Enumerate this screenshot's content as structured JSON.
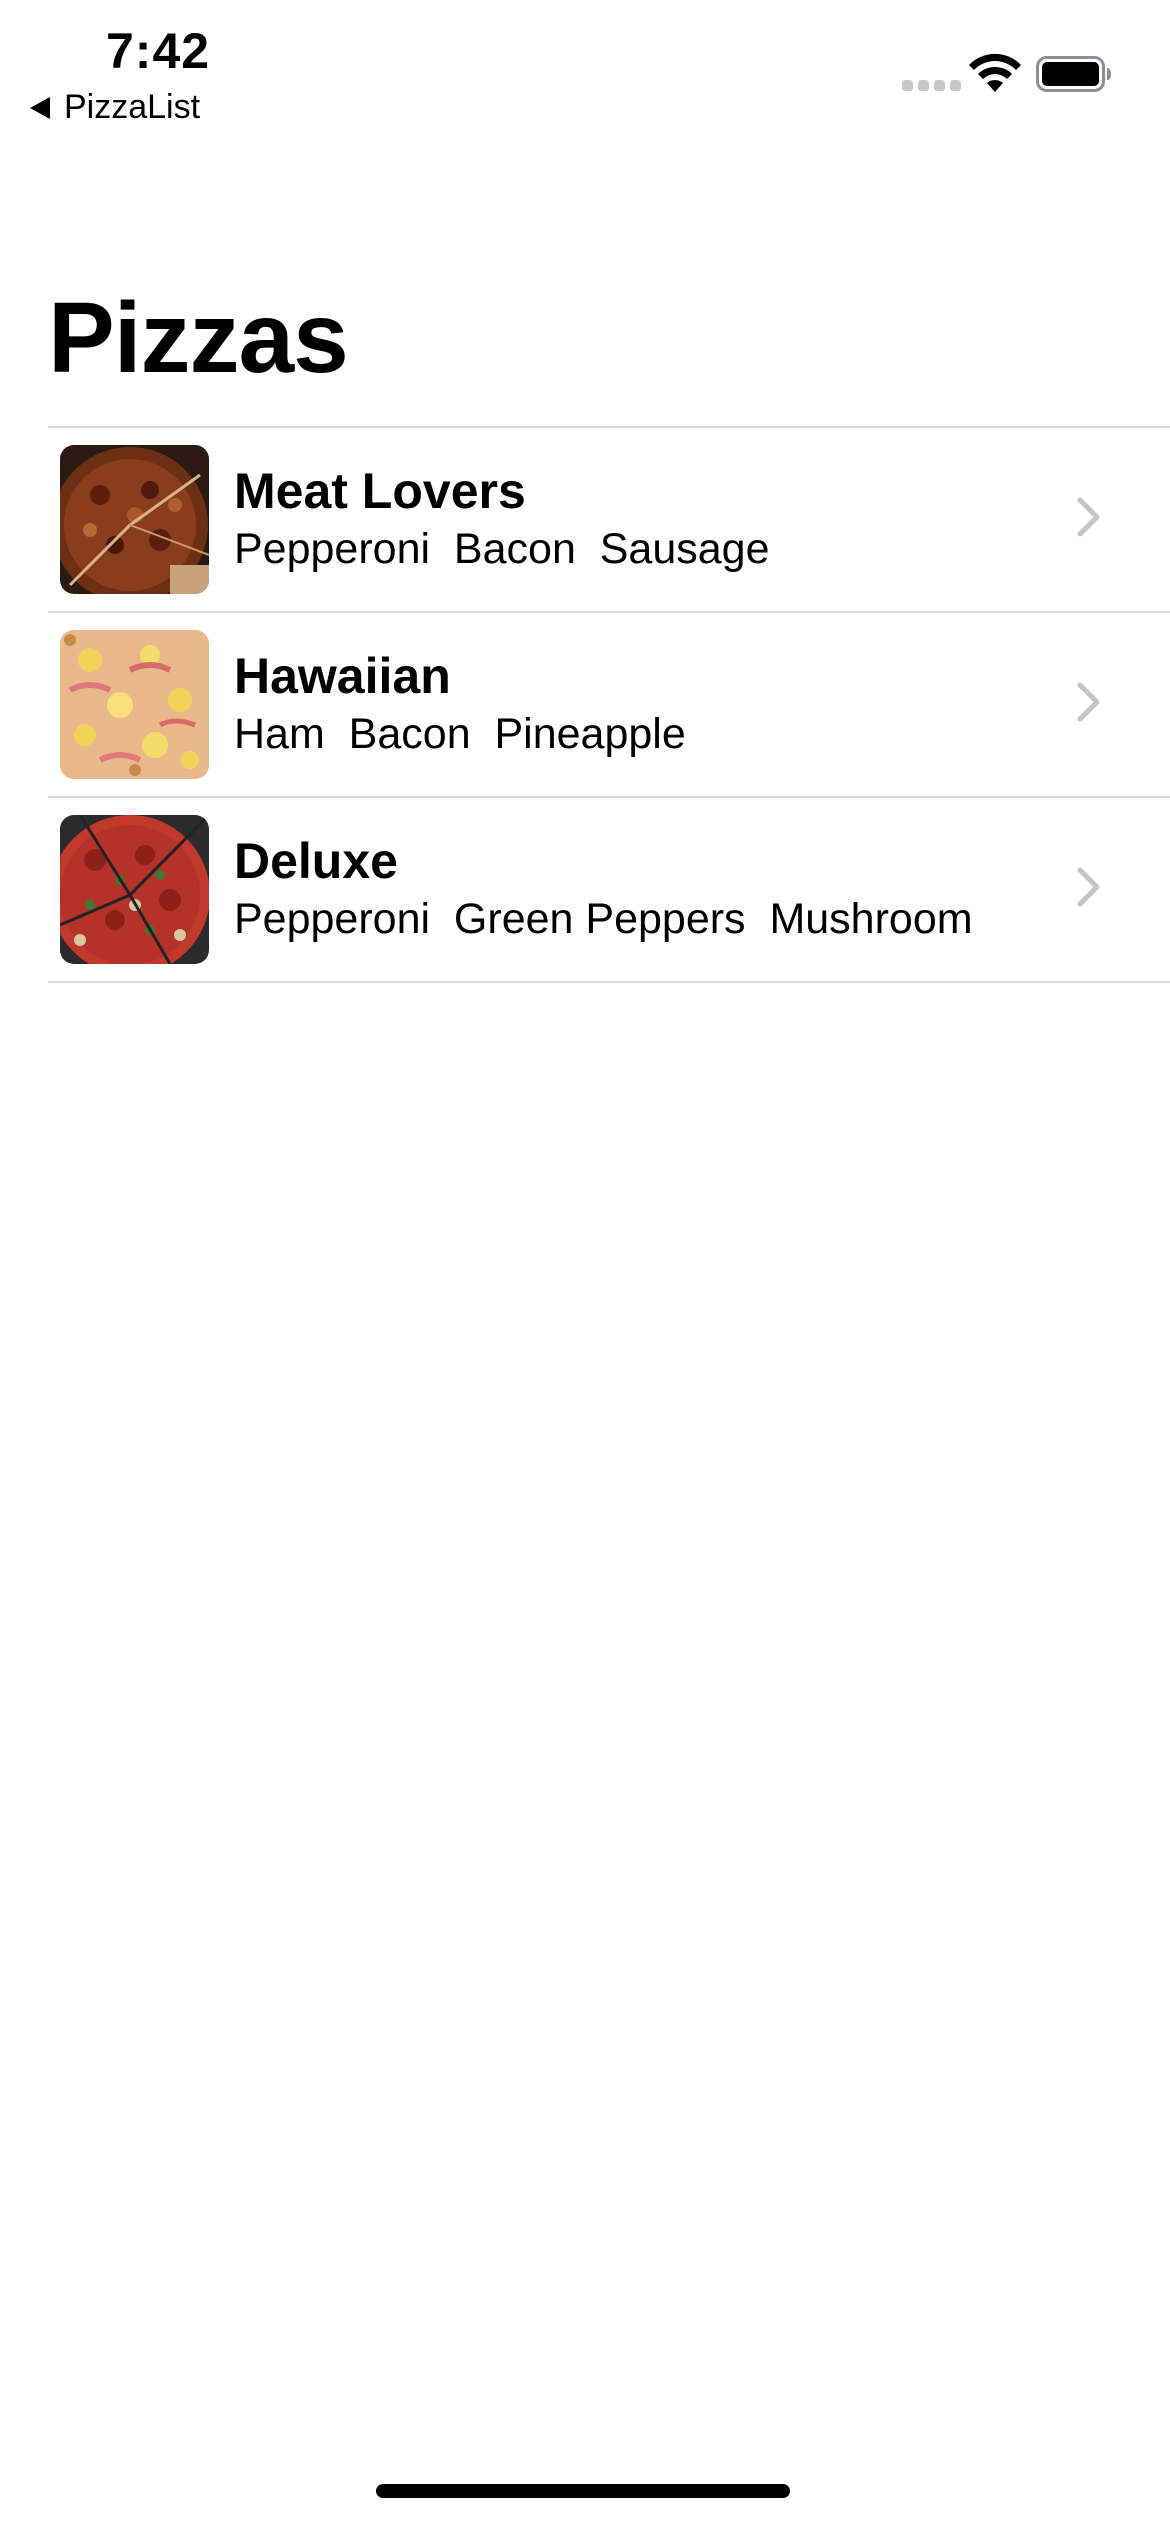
{
  "status_bar": {
    "time": "7:42",
    "back_label": "PizzaList"
  },
  "title": "Pizzas",
  "pizzas": [
    {
      "name": "Meat Lovers",
      "toppings": "Pepperoni  Bacon  Sausage",
      "image_icon": "meat-lovers-pizza-photo"
    },
    {
      "name": "Hawaiian",
      "toppings": "Ham  Bacon  Pineapple",
      "image_icon": "hawaiian-pizza-photo"
    },
    {
      "name": "Deluxe",
      "toppings": "Pepperoni  Green Peppers  Mushroom",
      "image_icon": "deluxe-pizza-photo"
    }
  ],
  "colors": {
    "separator": "#dcdcdc",
    "chevron": "#c4c4c8",
    "text": "#000000"
  }
}
